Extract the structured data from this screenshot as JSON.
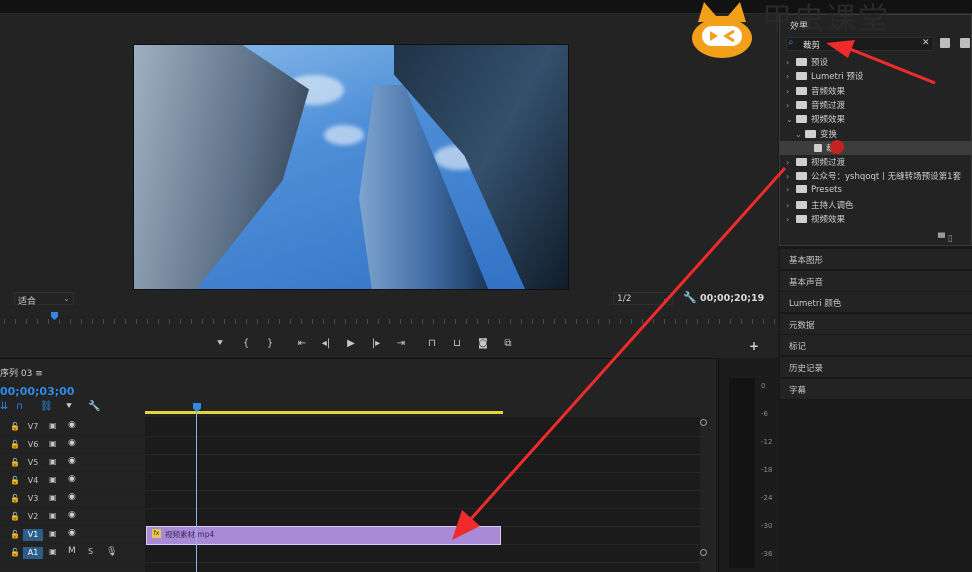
{
  "watermark": "甲虫课堂",
  "program_monitor": {
    "fit_select": "适合",
    "resolution_select": "1/2",
    "timecode": "00;00;20;19"
  },
  "timeline": {
    "sequence_tab": "序列 03",
    "current_timecode": "00;00;03;00",
    "tracks": [
      {
        "name": "V7",
        "type": "video"
      },
      {
        "name": "V6",
        "type": "video"
      },
      {
        "name": "V5",
        "type": "video"
      },
      {
        "name": "V4",
        "type": "video"
      },
      {
        "name": "V3",
        "type": "video"
      },
      {
        "name": "V2",
        "type": "video"
      },
      {
        "name": "V1",
        "type": "video",
        "selected": true
      },
      {
        "name": "A1",
        "type": "audio",
        "selected": true,
        "m": "M",
        "s": "S"
      }
    ],
    "clip": {
      "fx_badge": "fx",
      "name": "视频素材.mp4"
    }
  },
  "meter": {
    "labels": [
      "0",
      "-6",
      "-12",
      "-18",
      "-24",
      "-30",
      "-36"
    ]
  },
  "effects_panel": {
    "title": "效果",
    "search_value": "裁剪",
    "items": [
      {
        "label": "预设",
        "indent": 0,
        "expanded": false
      },
      {
        "label": "Lumetri 预设",
        "indent": 0,
        "expanded": false
      },
      {
        "label": "音频效果",
        "indent": 0,
        "expanded": false
      },
      {
        "label": "音频过渡",
        "indent": 0,
        "expanded": false
      },
      {
        "label": "视频效果",
        "indent": 0,
        "expanded": true
      },
      {
        "label": "变换",
        "indent": 1,
        "expanded": true
      },
      {
        "label": "裁剪",
        "indent": 2,
        "selected": true
      },
      {
        "label": "视频过渡",
        "indent": 0,
        "expanded": false
      },
      {
        "label": "公众号：yshqoqt丨无缝转场预设第1套",
        "indent": 0,
        "expanded": false
      },
      {
        "label": "Presets",
        "indent": 0,
        "expanded": false
      },
      {
        "label": "主持人调色",
        "indent": 0,
        "expanded": false
      },
      {
        "label": "视频效果",
        "indent": 0,
        "expanded": false
      }
    ]
  },
  "side_panels": [
    "基本图形",
    "基本声音",
    "Lumetri 颜色",
    "元数据",
    "标记",
    "历史记录",
    "字幕"
  ],
  "colors": {
    "accent": "#2f8ae6",
    "clip": "#a88ad6",
    "annotation_arrow": "#ef2b2b",
    "playhead_range": "#e6d23a"
  }
}
